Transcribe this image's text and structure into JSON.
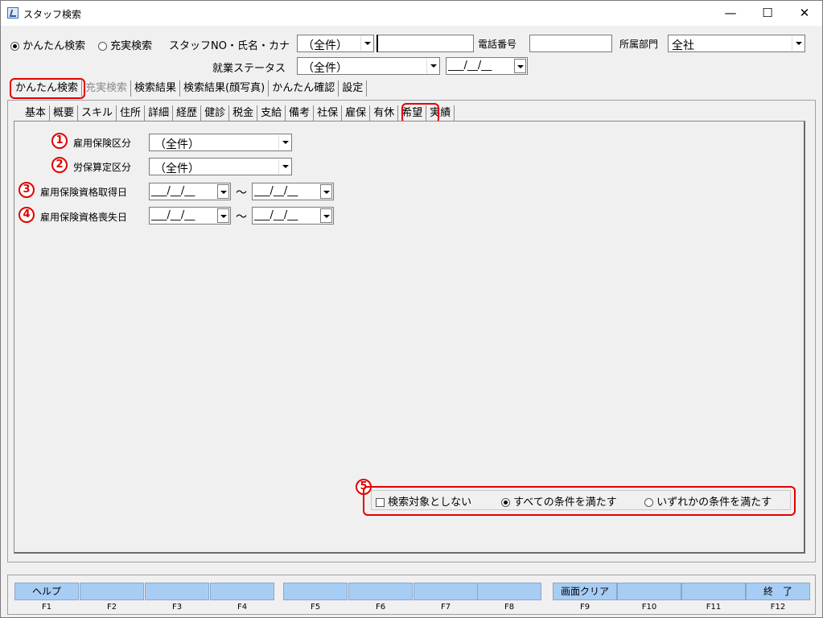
{
  "window": {
    "title": "スタッフ検索",
    "minimize": "—",
    "maximize": "☐",
    "close": "✕"
  },
  "search_mode": {
    "simple": "かんたん検索",
    "full": "充実検索",
    "selected": "simple"
  },
  "header": {
    "staff_label": "スタッフNO・氏名・カナ",
    "staff_combo": "（全件）",
    "staff_input": "",
    "phone_label": "電話番号",
    "phone_input": "",
    "dept_label": "所属部門",
    "dept_value": "全社",
    "status_label": "就業ステータス",
    "status_value": "（全件）",
    "status_date": "___/__/__"
  },
  "main_tabs": [
    "かんたん検索",
    "充実検索",
    "検索結果",
    "検索結果(顔写真)",
    "かんたん確認",
    "設定"
  ],
  "sub_tabs": [
    "基本",
    "概要",
    "スキル",
    "住所",
    "詳細",
    "経歴",
    "健診",
    "税金",
    "支給",
    "備考",
    "社保",
    "雇保",
    "有休",
    "希望",
    "実績"
  ],
  "fields": {
    "f1": {
      "num": "1",
      "label": "雇用保険区分",
      "value": "（全件）"
    },
    "f2": {
      "num": "2",
      "label": "労保算定区分",
      "value": "（全件）"
    },
    "f3": {
      "num": "3",
      "label": "雇用保険資格取得日",
      "from": "___/__/__",
      "to": "___/__/__"
    },
    "f4": {
      "num": "4",
      "label": "雇用保険資格喪失日",
      "from": "___/__/__",
      "to": "___/__/__"
    },
    "tilde": "～"
  },
  "conditions": {
    "num": "5",
    "exclude": "検索対象としない",
    "all": "すべての条件を満たす",
    "any": "いずれかの条件を満たす",
    "selected": "all"
  },
  "function_keys": [
    {
      "label": "ヘルプ",
      "key": "F1"
    },
    {
      "label": "",
      "key": "F2"
    },
    {
      "label": "",
      "key": "F3"
    },
    {
      "label": "",
      "key": "F4"
    },
    {
      "label": "",
      "key": "F5"
    },
    {
      "label": "",
      "key": "F6"
    },
    {
      "label": "",
      "key": "F7"
    },
    {
      "label": "",
      "key": "F8"
    },
    {
      "label": "画面クリア",
      "key": "F9"
    },
    {
      "label": "",
      "key": "F10"
    },
    {
      "label": "",
      "key": "F11"
    },
    {
      "label": "終　了",
      "key": "F12"
    }
  ],
  "colors": {
    "highlight": "#e30000",
    "fkey_bg": "#a8cdf5"
  }
}
